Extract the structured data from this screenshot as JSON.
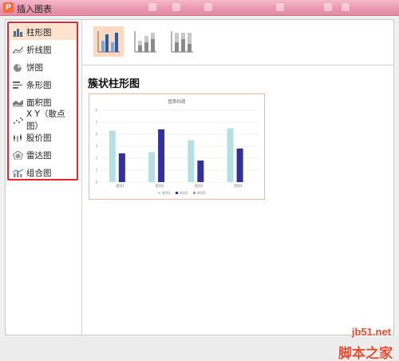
{
  "window": {
    "title": "插入图表",
    "logo_glyph": "P"
  },
  "chart_types": [
    {
      "label": "柱形图",
      "icon": "column-chart-icon",
      "selected": true
    },
    {
      "label": "折线图",
      "icon": "line-chart-icon",
      "selected": false
    },
    {
      "label": "饼图",
      "icon": "pie-chart-icon",
      "selected": false
    },
    {
      "label": "条形图",
      "icon": "bar-chart-icon",
      "selected": false
    },
    {
      "label": "面积图",
      "icon": "area-chart-icon",
      "selected": false
    },
    {
      "label": "X Y（散点图）",
      "icon": "scatter-chart-icon",
      "selected": false
    },
    {
      "label": "股价图",
      "icon": "stock-chart-icon",
      "selected": false
    },
    {
      "label": "雷达图",
      "icon": "radar-chart-icon",
      "selected": false
    },
    {
      "label": "组合图",
      "icon": "combo-chart-icon",
      "selected": false
    }
  ],
  "subtypes": [
    {
      "name": "clustered-column",
      "selected": true
    },
    {
      "name": "stacked-column",
      "selected": false
    },
    {
      "name": "percent-stacked-column",
      "selected": false
    }
  ],
  "selected_subtype_heading": "簇状柱形图",
  "colors": {
    "series1": "#b5e0e3",
    "series2": "#32309a",
    "highlight_border": "#e8252a",
    "selection_bg": "#fde2cf"
  },
  "chart_data": {
    "type": "bar",
    "title": "图表标题",
    "categories": [
      "类别1",
      "类别2",
      "类别3",
      "类别4"
    ],
    "series": [
      {
        "name": "系列1",
        "values": [
          4.3,
          2.5,
          3.5,
          4.5
        ]
      },
      {
        "name": "系列2",
        "values": [
          2.4,
          4.4,
          1.8,
          2.8
        ]
      },
      {
        "name": "系列3",
        "values": [
          0,
          0,
          0,
          0
        ]
      }
    ],
    "ylim": [
      0,
      6
    ],
    "yticks": [
      0,
      1,
      2,
      3,
      4,
      5,
      6
    ],
    "legend_position": "bottom",
    "grid": true
  },
  "watermark": {
    "url": "jb51.net",
    "site": "脚本之家"
  }
}
